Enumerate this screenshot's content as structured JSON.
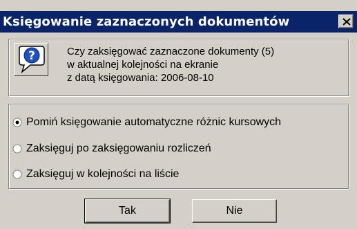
{
  "dialog": {
    "title": "Księgowanie zaznaczonych dokumentów",
    "close_icon": "close-x"
  },
  "message": {
    "icon": "question-icon",
    "lines": [
      "Czy zaksięgować zaznaczone dokumenty (5)",
      "w aktualnej kolejności na ekranie",
      "z datą księgowania: 2006-08-10"
    ]
  },
  "options": [
    {
      "label": "Pomiń księgowanie automatyczne różnic kursowych",
      "selected": true
    },
    {
      "label": "Zaksięguj po zaksięgowaniu rozliczeń",
      "selected": false
    },
    {
      "label": "Zaksięguj w kolejności na liście",
      "selected": false
    }
  ],
  "buttons": {
    "yes": "Tak",
    "no": "Nie"
  }
}
